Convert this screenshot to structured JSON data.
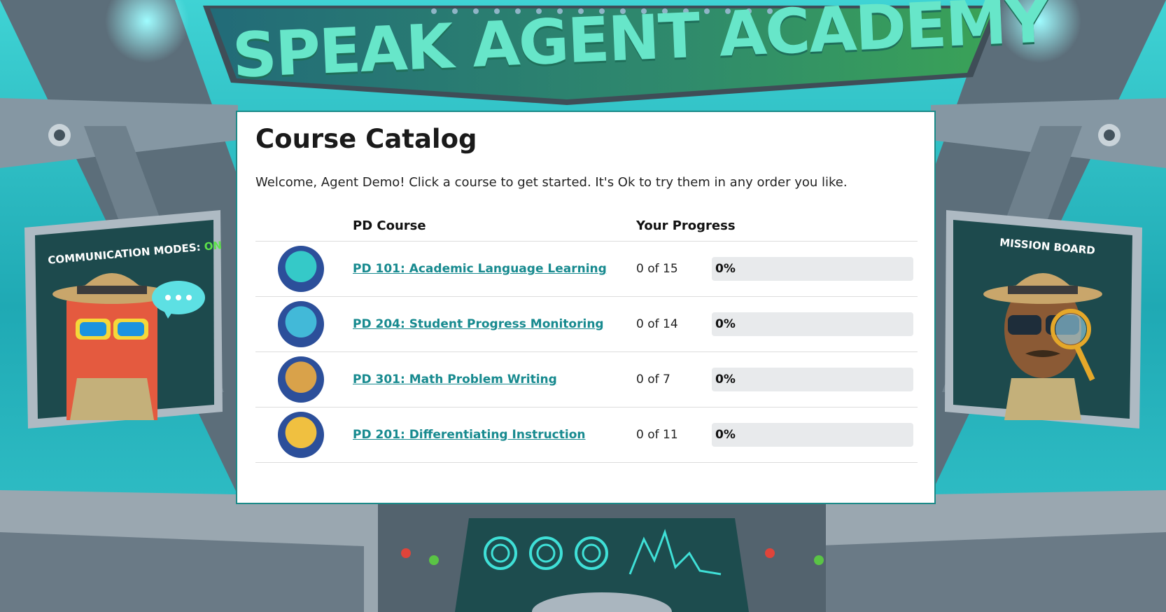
{
  "banner": {
    "title": "SPEAK AGENT ACADEMY"
  },
  "left_monitor": {
    "label": "COMMUNICATION MODES:",
    "status": "ON"
  },
  "right_monitor": {
    "label": "MISSION BOARD"
  },
  "catalog": {
    "title": "Course Catalog",
    "welcome": "Welcome, Agent Demo! Click a course to get started. It's Ok to try them in any order you like.",
    "headers": {
      "course": "PD Course",
      "progress": "Your Progress"
    },
    "courses": [
      {
        "title": "PD 101: Academic Language Learning",
        "count": "0 of 15",
        "percent_label": "0%",
        "progress": 0,
        "badge": "academic-language-badge-icon"
      },
      {
        "title": "PD 204: Student Progress Monitoring",
        "count": "0 of 14",
        "percent_label": "0%",
        "progress": 0,
        "badge": "progress-monitoring-badge-icon"
      },
      {
        "title": "PD 301: Math Problem Writing",
        "count": "0 of 7",
        "percent_label": "0%",
        "progress": 0,
        "badge": "math-writing-badge-icon"
      },
      {
        "title": "PD 201: Differentiating Instruction",
        "count": "0 of 11",
        "percent_label": "0%",
        "progress": 0,
        "badge": "differentiating-badge-icon"
      }
    ]
  },
  "colors": {
    "accent": "#178a8f",
    "panel_border": "#1b8a88",
    "progress_track": "#e8eaec"
  }
}
